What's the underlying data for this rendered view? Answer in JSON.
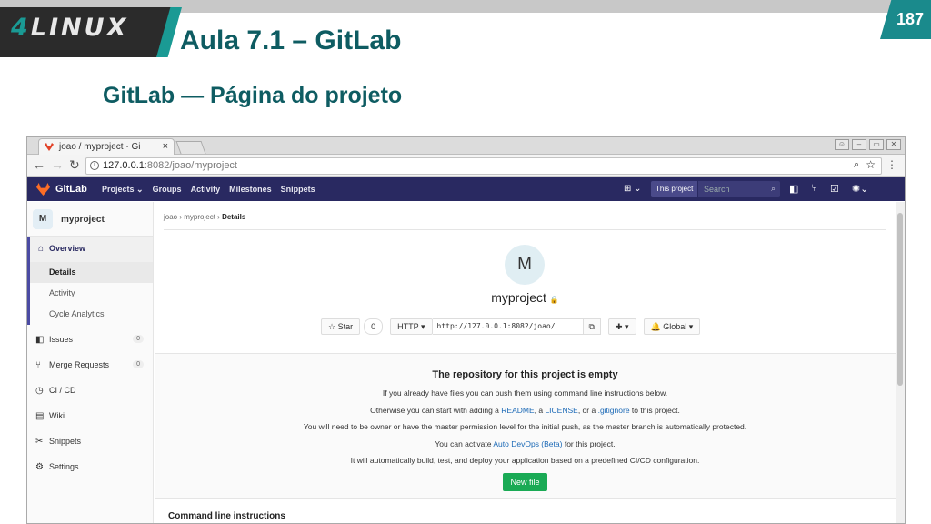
{
  "slide": {
    "logo_digit": "4",
    "logo_word": "LINUX",
    "title": "Aula 7.1 – GitLab",
    "page_number": "187",
    "subtitle": "GitLab — Página do projeto"
  },
  "browser": {
    "tab_title": "joao / myproject · Gi",
    "tab_close": "×",
    "url_host": "127.0.0.1",
    "url_rest": ":8082/joao/myproject"
  },
  "gitlab_nav": {
    "brand": "GitLab",
    "menu": [
      "Projects ⌄",
      "Groups",
      "Activity",
      "Milestones",
      "Snippets"
    ],
    "scope": "This project",
    "search_placeholder": "Search"
  },
  "sidebar": {
    "avatar_letter": "M",
    "project_name": "myproject",
    "overview": "Overview",
    "overview_sub": [
      "Details",
      "Activity",
      "Cycle Analytics"
    ],
    "items": [
      {
        "label": "Issues",
        "count": "0"
      },
      {
        "label": "Merge Requests",
        "count": "0"
      },
      {
        "label": "CI / CD"
      },
      {
        "label": "Wiki"
      },
      {
        "label": "Snippets"
      },
      {
        "label": "Settings"
      }
    ]
  },
  "main": {
    "breadcrumb": [
      "joao",
      "myproject",
      "Details"
    ],
    "avatar_letter": "M",
    "project_title": "myproject",
    "star_label": "Star",
    "star_count": "0",
    "protocol": "HTTP",
    "clone_url": "http://127.0.0.1:8082/joao/",
    "visibility": "Global",
    "empty_title": "The repository for this project is empty",
    "line1": "If you already have files you can push them using command line instructions below.",
    "line2_pre": "Otherwise you can start with adding a",
    "link_readme": "README",
    "link_license": "LICENSE",
    "line2_or": ", or a",
    "link_gitignore": ".gitignore",
    "line2_post": "to this project.",
    "line3": "You will need to be owner or have the master permission level for the initial push, as the master branch is automatically protected.",
    "line4_pre": "You can activate",
    "link_autodevops": "Auto DevOps (Beta)",
    "line4_post": "for this project.",
    "line5": "It will automatically build, test, and deploy your application based on a predefined CI/CD configuration.",
    "new_file": "New file",
    "cli_heading": "Command line instructions"
  }
}
